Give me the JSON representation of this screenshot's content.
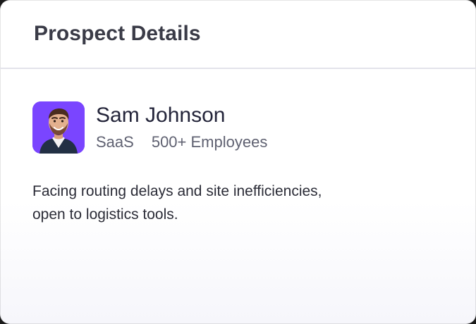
{
  "card": {
    "title": "Prospect Details"
  },
  "prospect": {
    "name": "Sam Johnson",
    "industry": "SaaS",
    "company_size": "500+ Employees",
    "description_lines": [
      "Facing routing delays and site inefficiencies,",
      "open to logistics tools."
    ],
    "avatar": {
      "icon": "person-portrait-icon",
      "background_color": "#7A45FF"
    }
  }
}
